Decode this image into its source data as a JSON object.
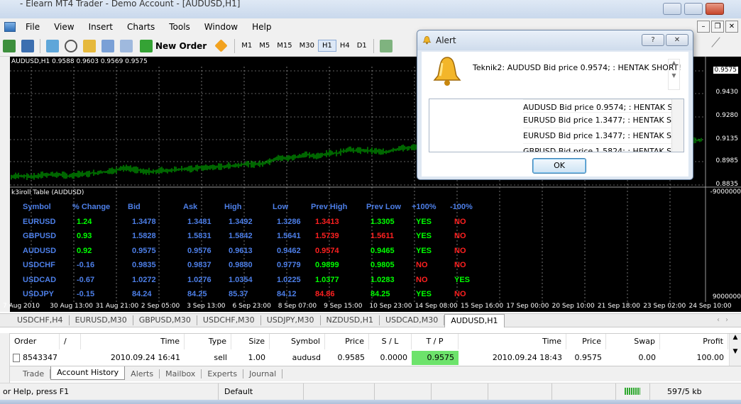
{
  "window": {
    "title": "- Elearn MT4 Trader - Demo Account - [AUDUSD,H1]"
  },
  "menu": [
    "File",
    "View",
    "Insert",
    "Charts",
    "Tools",
    "Window",
    "Help"
  ],
  "toolbar": {
    "new_order": "New Order",
    "timeframes": [
      "M1",
      "M5",
      "M15",
      "M30",
      "H1",
      "H4",
      "D1"
    ],
    "active_timeframe": "H1"
  },
  "chart": {
    "title": "AUDUSD,H1  0.9588 0.9603 0.9569 0.9575",
    "price_scale": [
      "0.9575",
      "0.9430",
      "0.9280",
      "0.9135",
      "0.8985",
      "0.8835"
    ],
    "indicator_scale_top": "-9000000",
    "indicator_scale_bottom": "9000000",
    "indicator_title": "k3iroll Table (AUDUSD)",
    "time_axis": [
      "7 Aug 2010",
      "30 Aug 13:00",
      "31 Aug 21:00",
      "2 Sep 05:00",
      "3 Sep 13:00",
      "6 Sep 23:00",
      "8 Sep 07:00",
      "9 Sep 15:00",
      "10 Sep 23:00",
      "14 Sep 08:00",
      "15 Sep 16:00",
      "17 Sep 00:00",
      "20 Sep 10:00",
      "21 Sep 18:00",
      "23 Sep 02:00",
      "24 Sep 10:00"
    ],
    "colors": {
      "background": "#000000",
      "candles": "#00cc00",
      "grid": "#ffffff"
    }
  },
  "indicator_table": {
    "headers": [
      "Symbol",
      "% Change",
      "Bid",
      "Ask",
      "High",
      "Low",
      "Prev High",
      "Prev Low",
      "+100%",
      "-100%"
    ],
    "rows": [
      {
        "symbol": "EURUSD",
        "change": "1.24",
        "bid": "1.3478",
        "ask": "1.3481",
        "high": "1.3492",
        "low": "1.3286",
        "prev_high": "1.3413",
        "prev_low": "1.3305",
        "plus": "YES",
        "minus": "NO",
        "change_color": "#00ff00",
        "ph_color": "#ff2020",
        "pl_color": "#00ff00",
        "plus_color": "#00ff00",
        "minus_color": "#ff2020"
      },
      {
        "symbol": "GBPUSD",
        "change": "0.93",
        "bid": "1.5828",
        "ask": "1.5831",
        "high": "1.5842",
        "low": "1.5641",
        "prev_high": "1.5739",
        "prev_low": "1.5611",
        "plus": "YES",
        "minus": "NO",
        "change_color": "#00ff00",
        "ph_color": "#ff2020",
        "pl_color": "#ff2020",
        "plus_color": "#00ff00",
        "minus_color": "#ff2020"
      },
      {
        "symbol": "AUDUSD",
        "change": "0.92",
        "bid": "0.9575",
        "ask": "0.9576",
        "high": "0.9613",
        "low": "0.9462",
        "prev_high": "0.9574",
        "prev_low": "0.9465",
        "plus": "YES",
        "minus": "NO",
        "change_color": "#00ff00",
        "ph_color": "#ff2020",
        "pl_color": "#00ff00",
        "plus_color": "#00ff00",
        "minus_color": "#ff2020"
      },
      {
        "symbol": "USDCHF",
        "change": "-0.16",
        "bid": "0.9835",
        "ask": "0.9837",
        "high": "0.9880",
        "low": "0.9779",
        "prev_high": "0.9899",
        "prev_low": "0.9805",
        "plus": "NO",
        "minus": "NO",
        "change_color": "#4d7fe8",
        "ph_color": "#00ff00",
        "pl_color": "#00ff00",
        "plus_color": "#ff2020",
        "minus_color": "#ff2020"
      },
      {
        "symbol": "USDCAD",
        "change": "-0.67",
        "bid": "1.0272",
        "ask": "1.0276",
        "high": "1.0354",
        "low": "1.0225",
        "prev_high": "1.0377",
        "prev_low": "1.0283",
        "plus": "NO",
        "minus": "YES",
        "change_color": "#4d7fe8",
        "ph_color": "#00ff00",
        "pl_color": "#00ff00",
        "plus_color": "#ff2020",
        "minus_color": "#00ff00"
      },
      {
        "symbol": "USDJPY",
        "change": "-0.15",
        "bid": "84.24",
        "ask": "84.25",
        "high": "85.37",
        "low": "84.12",
        "prev_high": "84.86",
        "prev_low": "84.25",
        "plus": "YES",
        "minus": "NO",
        "change_color": "#4d7fe8",
        "ph_color": "#ff2020",
        "pl_color": "#00ff00",
        "plus_color": "#00ff00",
        "minus_color": "#ff2020"
      }
    ]
  },
  "chart_tabs": [
    "USDCHF,H4",
    "EURUSD,M30",
    "GBPUSD,M30",
    "USDCHF,M30",
    "USDJPY,M30",
    "NZDUSD,H1",
    "USDCAD,M30",
    "AUDUSD,H1"
  ],
  "active_chart_tab": "AUDUSD,H1",
  "terminal": {
    "columns": [
      "Order",
      "/",
      "Time",
      "Type",
      "Size",
      "Symbol",
      "Price",
      "S / L",
      "T / P",
      "Time",
      "Price",
      "Swap",
      "Profit"
    ],
    "row": {
      "order": "8543347",
      "time": "2010.09.24 16:41",
      "type": "sell",
      "size": "1.00",
      "symbol": "audusd",
      "price": "0.9585",
      "sl": "0.0000",
      "tp": "0.9575",
      "close_time": "2010.09.24 18:43",
      "close_price": "0.9575",
      "swap": "0.00",
      "profit": "100.00"
    },
    "tabs": [
      "Trade",
      "Account History",
      "Alerts",
      "Mailbox",
      "Experts",
      "Journal"
    ],
    "active_tab": "Account History"
  },
  "statusbar": {
    "help": "or Help, press F1",
    "profile": "Default",
    "traffic": "597/5 kb"
  },
  "alert": {
    "title": "Alert",
    "message": "Teknik2: AUDUSD  Bid price 0.9574;  : HENTAK SHORT!",
    "list": [
      "AUDUSD  Bid price 0.9574;  : HENTAK S...",
      "EURUSD  Bid price 1.3477;  : HENTAK S...",
      "EURUSD  Bid price 1.3477;  : HENTAK S...",
      "GBPUSD  Bid price 1.5824;  : HENTAK S..."
    ],
    "help_btn": "?",
    "close_btn": "✕",
    "ok": "OK"
  }
}
